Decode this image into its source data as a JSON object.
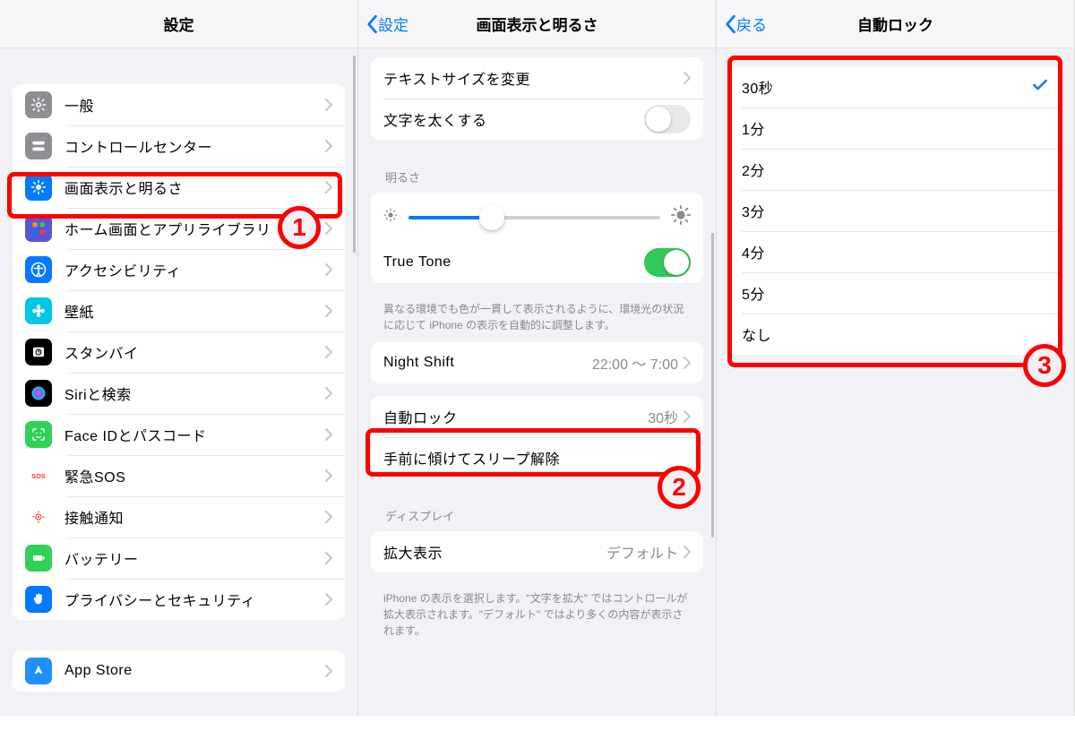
{
  "panel1": {
    "title": "設定",
    "items": [
      {
        "label": "一般",
        "icon_name": "gear-icon",
        "bg": "#8e8e93"
      },
      {
        "label": "コントロールセンター",
        "icon_name": "switches-icon",
        "bg": "#8e8e93"
      },
      {
        "label": "画面表示と明るさ",
        "icon_name": "brightness-icon",
        "bg": "#007aff"
      },
      {
        "label": "ホーム画面とアプリライブラリ",
        "icon_name": "grid-icon",
        "bg": "#5856d6"
      },
      {
        "label": "アクセシビリティ",
        "icon_name": "accessibility-icon",
        "bg": "#007aff"
      },
      {
        "label": "壁紙",
        "icon_name": "flower-icon",
        "bg": "#00c7e6"
      },
      {
        "label": "スタンバイ",
        "icon_name": "standby-icon",
        "bg": "#000000"
      },
      {
        "label": "Siriと検索",
        "icon_name": "siri-icon",
        "bg": "#000000"
      },
      {
        "label": "Face IDとパスコード",
        "icon_name": "faceid-icon",
        "bg": "#30d158"
      },
      {
        "label": "緊急SOS",
        "icon_name": "sos-icon",
        "bg": "#ffffff",
        "txt": "#ff3b30"
      },
      {
        "label": "接触通知",
        "icon_name": "exposure-icon",
        "bg": "#ffffff",
        "txt": "#ff3b30"
      },
      {
        "label": "バッテリー",
        "icon_name": "battery-icon",
        "bg": "#30d158"
      },
      {
        "label": "プライバシーとセキュリティ",
        "icon_name": "hand-icon",
        "bg": "#007aff"
      }
    ],
    "items2": [
      {
        "label": "App Store",
        "icon_name": "appstore-icon",
        "bg": "#1e90ff"
      }
    ]
  },
  "panel2": {
    "back": "設定",
    "title": "画面表示と明るさ",
    "text_size": "テキストサイズを変更",
    "bold_text": "文字を太くする",
    "brightness_header": "明るさ",
    "true_tone": "True Tone",
    "true_tone_note": "異なる環境でも色が一貫して表示されるように、環境光の状況に応じて iPhone の表示を自動的に調整します。",
    "night_shift": "Night Shift",
    "night_shift_value": "22:00 ～ 7:00",
    "auto_lock": "自動ロック",
    "auto_lock_value": "30秒",
    "raise_wake": "手前に傾けてスリープ解除",
    "display_header": "ディスプレイ",
    "zoom": "拡大表示",
    "zoom_value": "デフォルト",
    "zoom_note": "iPhone の表示を選択します。\"文字を拡大\" ではコントロールが拡大表示されます。\"デフォルト\" ではより多くの内容が表示されます。"
  },
  "panel3": {
    "back": "戻る",
    "title": "自動ロック",
    "options": [
      "30秒",
      "1分",
      "2分",
      "3分",
      "4分",
      "5分",
      "なし"
    ],
    "selected": 0
  },
  "badges": {
    "b1": "1",
    "b2": "2",
    "b3": "3"
  },
  "colors": {
    "blue": "#007aff",
    "red": "#ff0000",
    "green": "#34c759"
  }
}
